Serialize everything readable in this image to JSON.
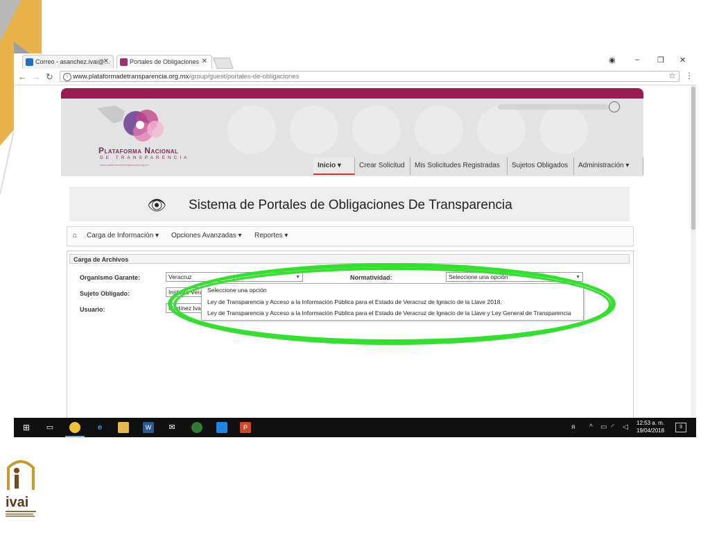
{
  "browser": {
    "tabs": [
      {
        "label": "Correo - asanchez.ivai@…"
      },
      {
        "label": "Portales de Obligaciones"
      }
    ],
    "url": {
      "host": "www.plataformadetransparencia.org.mx",
      "path": "/group/guest/portales-de-obligaciones"
    }
  },
  "header": {
    "logo_title": "Plataforma Nacional",
    "logo_subtitle": "DE TRANSPARENCIA",
    "logo_url": "www.plataformadetransparencia.org.mx"
  },
  "menu": {
    "items": [
      {
        "label": "Inicio ▾"
      },
      {
        "label": "Crear Solicitud"
      },
      {
        "label": "Mis Solicitudes Registradas"
      },
      {
        "label": "Sujetos Obligados"
      },
      {
        "label": "Administración ▾"
      }
    ]
  },
  "page": {
    "title": "Sistema de Portales de Obligaciones De Transparencia"
  },
  "subnav": {
    "items": [
      {
        "label": "Carga de Información ▾"
      },
      {
        "label": "Opciones Avanzadas ▾"
      },
      {
        "label": "Reportes ▾"
      }
    ]
  },
  "panel": {
    "title": "Carga de Archivos",
    "fields": {
      "organismo_label": "Organismo Garante:",
      "organismo_value": "Veracruz",
      "normatividad_label": "Normatividad:",
      "normatividad_value": "Seleccione una opción",
      "sujeto_label": "Sujeto Obligado:",
      "sujeto_value": "Instituto Vera",
      "usuario_label": "Usuario:",
      "usuario_value": "Martínez Iva"
    },
    "dropdown_options": [
      "Seleccione una opción",
      "Ley de Transparencia y Acceso a la Información Pública para el Estado de Veracruz de Ignacio de la Llave 2018.",
      "Ley de Transparencia y Acceso a la Información Pública para el Estado de Veracruz de Ignacio de la Llave y Ley General de Transparencia"
    ]
  },
  "taskbar": {
    "time": "12:53 a. m.",
    "date": "19/04/2018",
    "notifications": "3"
  },
  "colors": {
    "header_accent": "#9b1b52",
    "highlight_ring": "#33e02e",
    "active_tab_underline": "#c0392b"
  }
}
